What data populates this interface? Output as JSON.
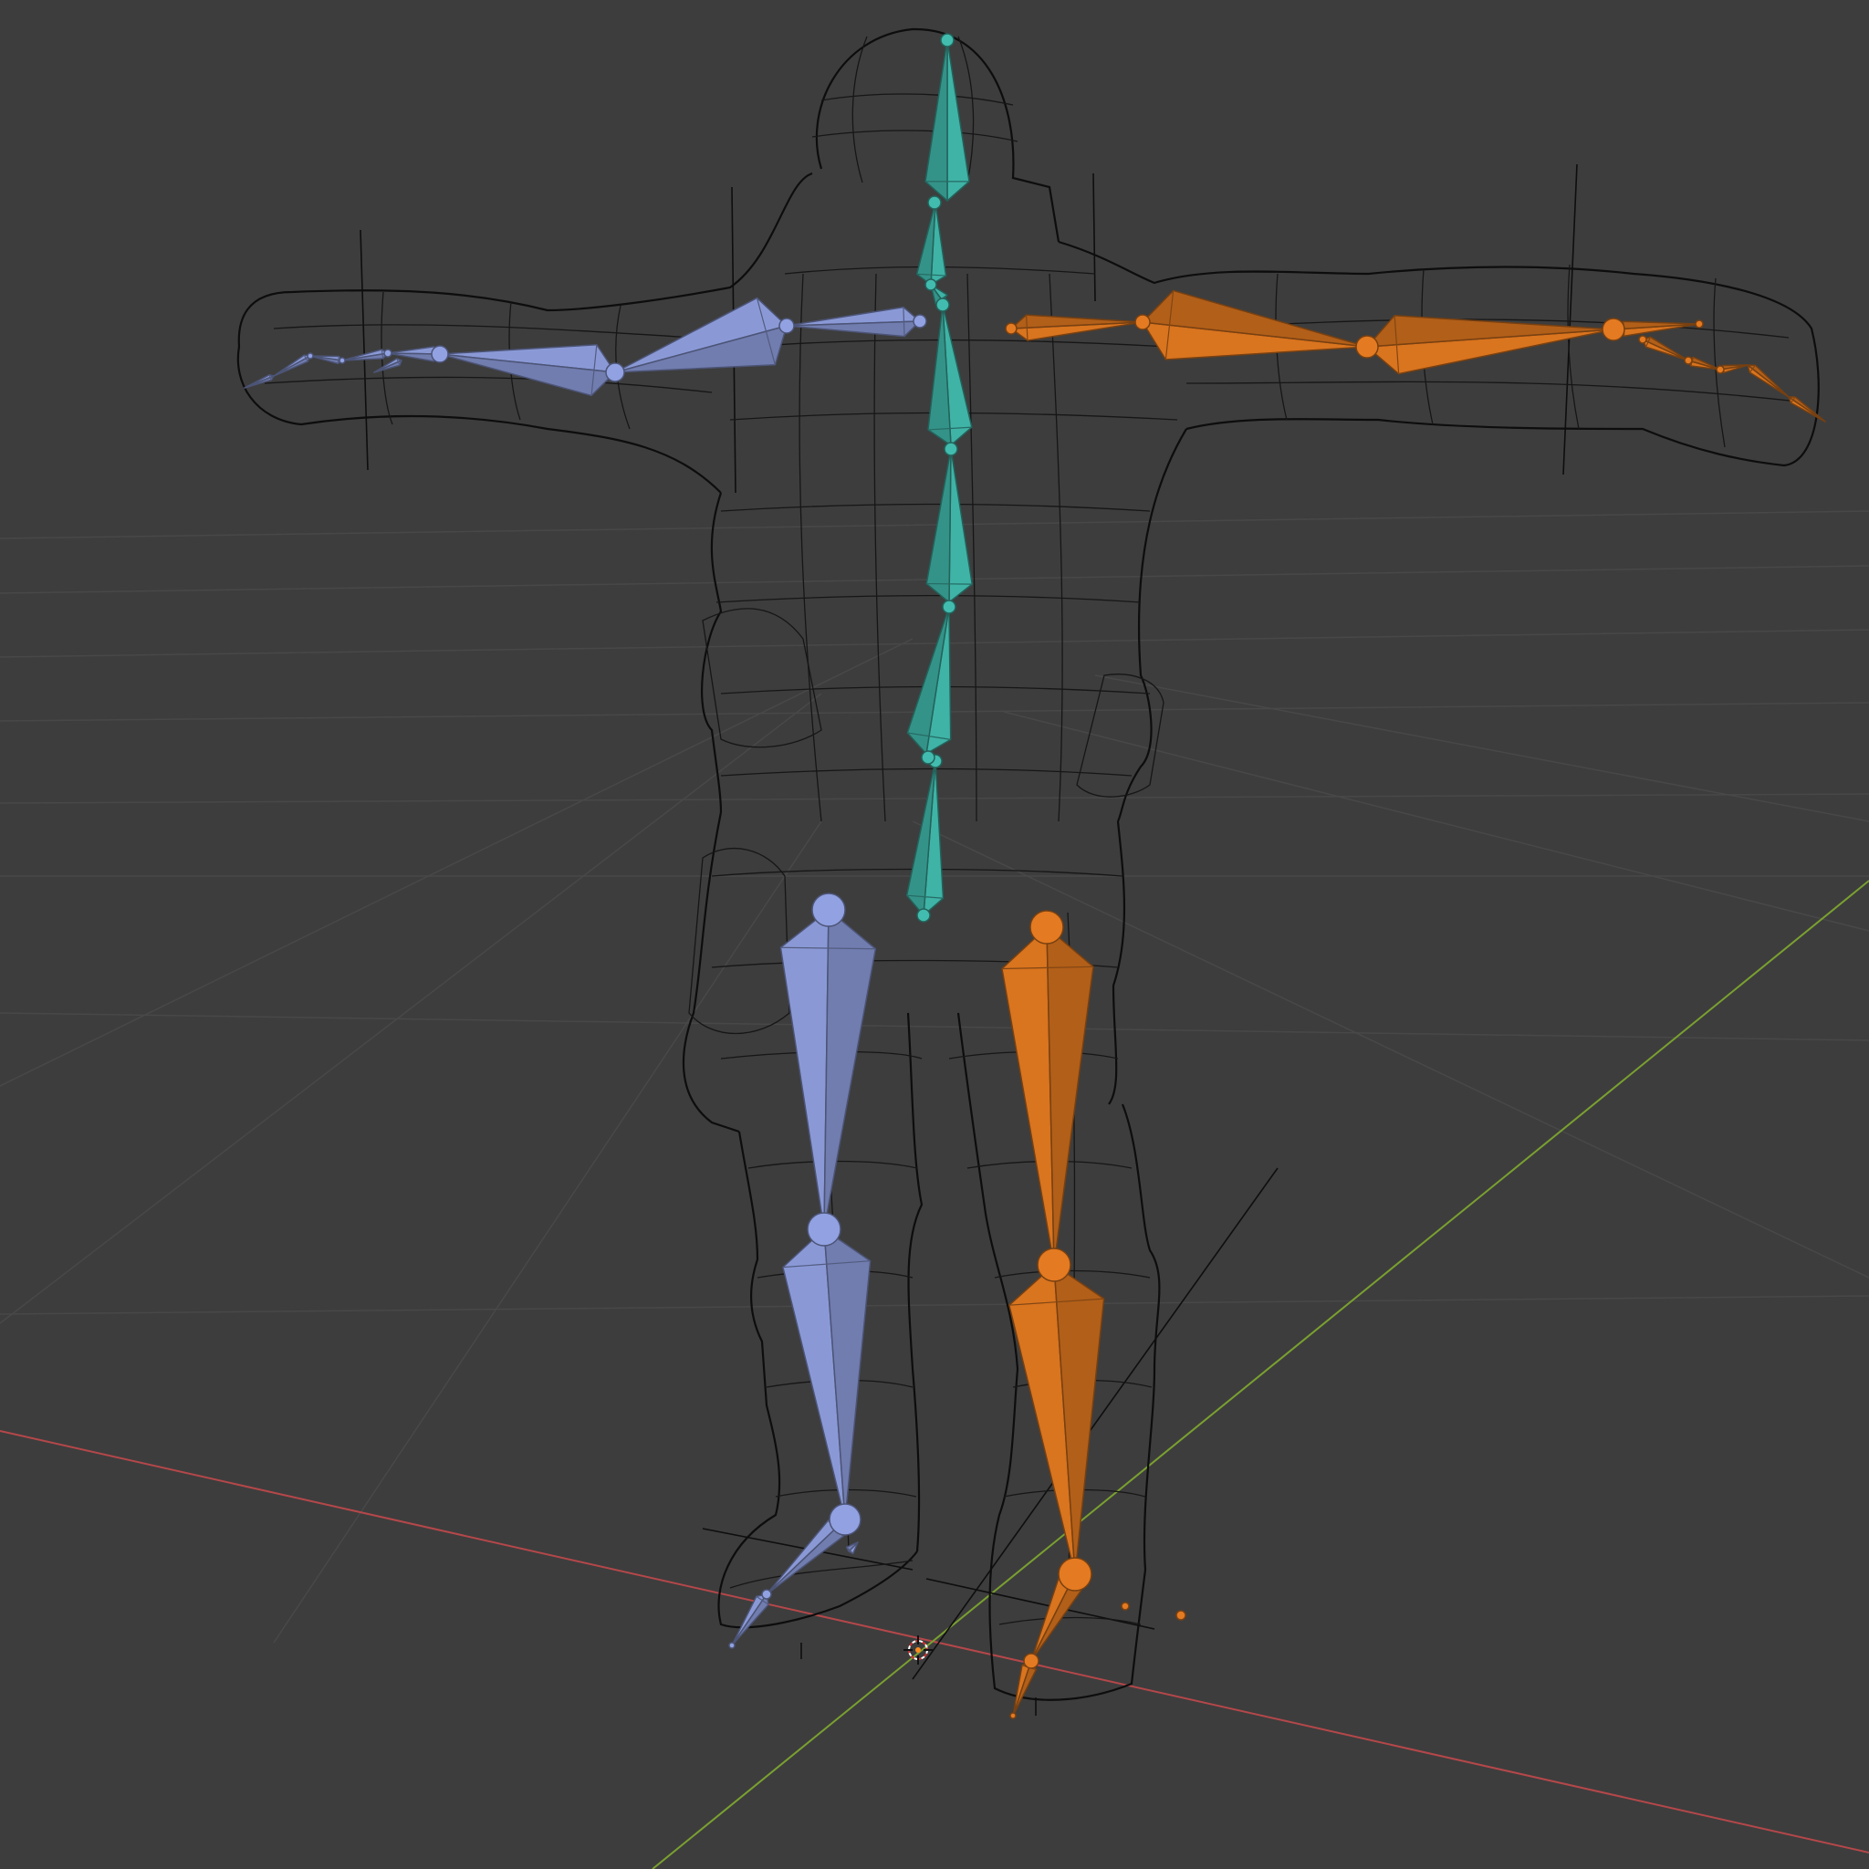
{
  "viewport": {
    "background": "#3d3d3d",
    "grid_color": "#4a4a4a",
    "x_axis_color": "#c0504d",
    "y_axis_color": "#7fa331",
    "mesh_color": "#161616",
    "display_mode": "wireframe",
    "object_mode": "pose"
  },
  "armature": {
    "spine_color": "#3fb3a6",
    "left_color": "#8a99d6",
    "right_color": "#d9741f",
    "chains": [
      {
        "name": "spine",
        "bones": [
          "hips",
          "spine",
          "spine1",
          "spine2",
          "neck",
          "neck1",
          "head"
        ]
      },
      {
        "name": "arm-left",
        "bones": [
          "shoulder",
          "upper-arm",
          "forearm",
          "hand",
          "fingers"
        ]
      },
      {
        "name": "arm-right",
        "bones": [
          "shoulder",
          "upper-arm",
          "forearm",
          "hand",
          "fingers"
        ]
      },
      {
        "name": "leg-left",
        "bones": [
          "thigh",
          "shin",
          "foot",
          "toe"
        ]
      },
      {
        "name": "leg-right",
        "bones": [
          "thigh",
          "shin",
          "foot",
          "toe"
        ]
      }
    ]
  },
  "scene_icons": [
    "3d-cursor-icon",
    "origin-icon"
  ]
}
